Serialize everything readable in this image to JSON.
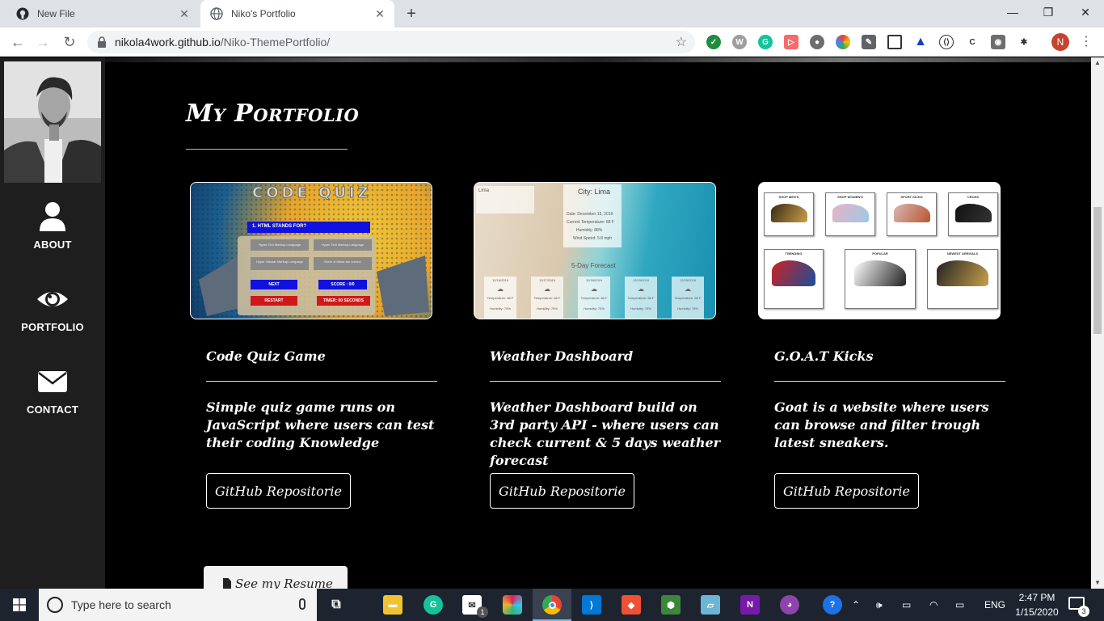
{
  "browser": {
    "tabs": [
      {
        "title": "New File",
        "active": false
      },
      {
        "title": "Niko's Portfolio",
        "active": true
      }
    ],
    "url_host": "nikola4work.github.io",
    "url_path": "/Niko-ThemePortfolio/",
    "profile_initial": "N"
  },
  "sidebar": {
    "items": [
      {
        "label": "ABOUT",
        "icon": "user-icon"
      },
      {
        "label": "PORTFOLIO",
        "icon": "eye-icon"
      },
      {
        "label": "CONTACT",
        "icon": "envelope-icon"
      }
    ]
  },
  "portfolio": {
    "heading": "My Portfolio",
    "projects": [
      {
        "title": "Code Quiz Game",
        "description": "Simple quiz game runs on JavaScript where users can test their coding Knowledge",
        "button": "GitHub Repositorie",
        "thumb": {
          "banner": "CODE QUIZ",
          "question": "1. HTML STANDS FOR?",
          "answers": [
            "Hyper Text Markup Language",
            "Hyper Text Markup Language",
            "Hyper Tabular Markup Language",
            "None of these are correct"
          ],
          "next": "NEXT",
          "score": "SCORE : 0/0",
          "restart": "RESTART",
          "timer": "TIMER: 00 SECONDS"
        }
      },
      {
        "title": "Weather Dashboard",
        "description": "Weather Dashboard build on 3rd party API - where users can check current & 5 days weather forecast",
        "button": "GitHub Repositorie",
        "thumb": {
          "search_value": "Lima",
          "city": "City: Lima",
          "date": "Date: December 15, 2019",
          "temp": "Current Temperature: 68 F",
          "humidity": "Humidity: 88%",
          "wind": "Wind Speed: 5.8 mph",
          "forecast_label": "5-Day Forecast",
          "forecast_dates": [
            "12/16/2019",
            "12/17/2019",
            "12/18/2019",
            "12/19/2019",
            "12/20/2019"
          ],
          "forecast_temp": "Temperature: 68 F",
          "forecast_humidity": "Humidity: 75%"
        }
      },
      {
        "title": "G.O.A.T Kicks",
        "description": "Goat is a website where users can browse and filter trough latest sneakers.",
        "button": "GitHub Repositorie",
        "thumb": {
          "labels": [
            "SHOP MEN'S",
            "SHOP WOMEN'S",
            "SPORT KICKS",
            "CROSS",
            "TRENDING",
            "POPULAR",
            "NEWEST ARRIVALS"
          ]
        }
      }
    ],
    "resume_button": "See my Resume"
  },
  "taskbar": {
    "search_placeholder": "Type here to search",
    "language": "ENG",
    "time": "2:47 PM",
    "date": "1/15/2020",
    "notification_count": "3",
    "mail_badge": "1"
  }
}
